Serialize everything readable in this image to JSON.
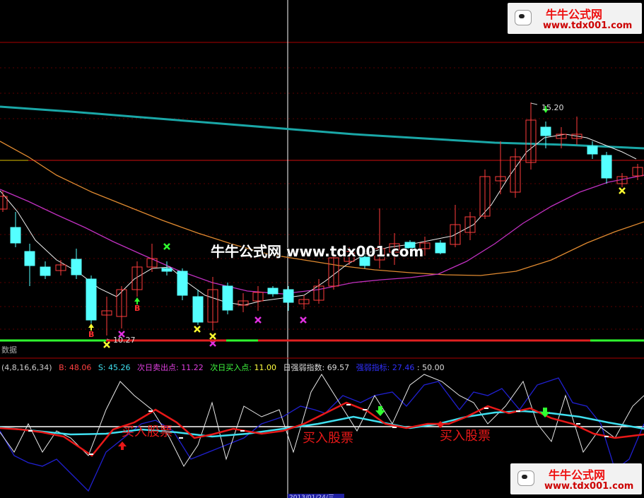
{
  "watermark": {
    "brand": "牛牛公式网",
    "url": "www.tdx001.com",
    "center_text": "牛牛公式网 www.tdx001.com"
  },
  "price_panel": {
    "high_label": "15.20",
    "low_label": "10.27",
    "buy_marks": [
      "B",
      "B"
    ],
    "colors": {
      "ma_long": "#1aa7a7",
      "ma_mid": "#c030c0",
      "ma_orange": "#e08a30",
      "ma_white": "#f0f0f0",
      "up_candle": "#ff3c3c",
      "down_candle": "#54ffff",
      "hline": "#d01010"
    }
  },
  "panel_divider_label": "数据",
  "indicator_header": {
    "params": "(4,8,16,6,34)",
    "b_label": "B:",
    "b_value": "48.06",
    "s_label": "S:",
    "s_value": "45.26",
    "sell_label": "次日卖出点:",
    "sell_value": "11.22",
    "buy_label": "次日买入点:",
    "buy_value": "11.00",
    "strength_label": "日强弱指数:",
    "strength_value": "69.57",
    "ref_label": "强弱指标:",
    "ref_value": "27.46",
    "mid_value": ": 50.00"
  },
  "indicator_annotations": [
    "买入股票",
    "买入股票",
    "买入股票"
  ],
  "bottom_axis_label": "2013/01/24/三"
}
